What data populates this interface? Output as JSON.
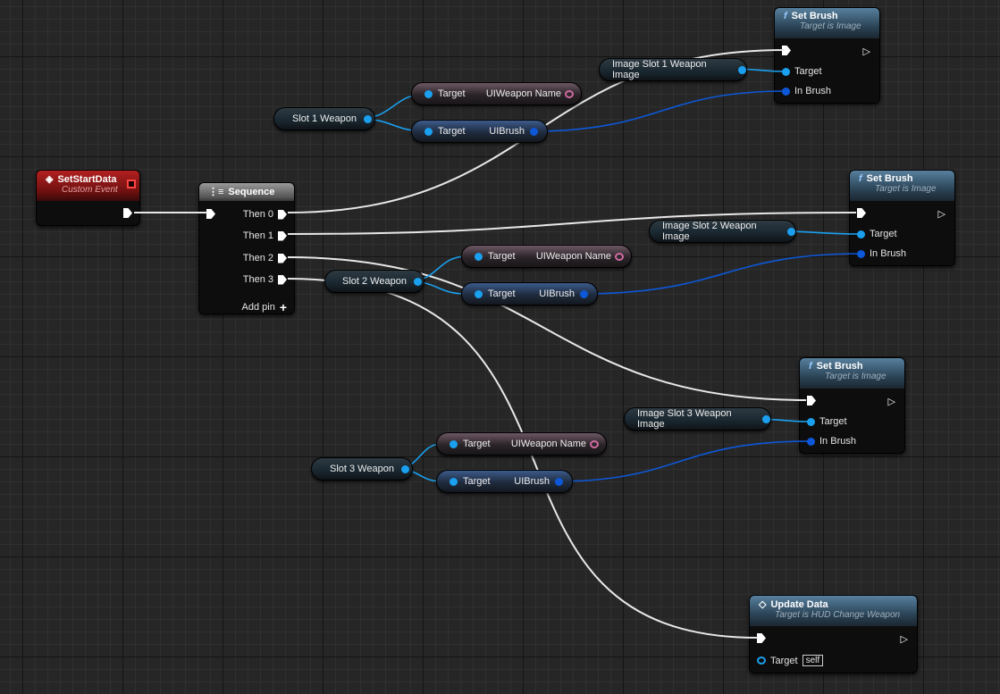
{
  "event_node": {
    "title": "SetStartData",
    "subtitle": "Custom Event",
    "icon": "diamond-event-icon",
    "color": "#b32020"
  },
  "sequence_node": {
    "title": "Sequence",
    "pins": [
      "Then 0",
      "Then 1",
      "Then 2",
      "Then 3"
    ],
    "add_pin": "Add pin"
  },
  "set_brush_nodes": [
    {
      "title": "Set Brush",
      "subtitle": "Target is Image",
      "target": "Target",
      "in_brush": "In Brush"
    },
    {
      "title": "Set Brush",
      "subtitle": "Target is Image",
      "target": "Target",
      "in_brush": "In Brush"
    },
    {
      "title": "Set Brush",
      "subtitle": "Target is Image",
      "target": "Target",
      "in_brush": "In Brush"
    }
  ],
  "image_vars": [
    "Image Slot 1 Weapon Image",
    "Image Slot 2 Weapon Image",
    "Image Slot 3 Weapon Image"
  ],
  "slot_vars": [
    "Slot 1 Weapon",
    "Slot 2 Weapon",
    "Slot 3 Weapon"
  ],
  "getters": {
    "target": "Target",
    "weapon_name": "UIWeapon Name",
    "brush": "UIBrush"
  },
  "update_node": {
    "title": "Update Data",
    "subtitle": "Target is HUD Change Weapon",
    "target": "Target",
    "self": "self"
  },
  "colors": {
    "exec": "#ffffff",
    "object_pin": "#1aa0ef",
    "struct_pin": "#0d58d8",
    "text_pin": "#d06aa0",
    "function_header": "#57809e"
  }
}
